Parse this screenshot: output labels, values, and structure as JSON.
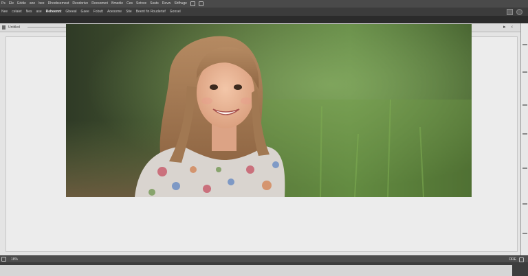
{
  "menubar": {
    "items": [
      "Ps",
      "Ele",
      "Eddie",
      "ane",
      "bee",
      "Dhoobsemost",
      "Reodorive",
      "Rocsomeri",
      "Bmedie",
      "Ces",
      "Sotvoc",
      "Ssuts",
      "Revw"
    ],
    "right_label": "Shfhuge"
  },
  "toolbar": {
    "items": [
      "Nee",
      "celaiet",
      "Nes",
      "ase",
      "Reheennt",
      "Gbeeal",
      "Gaee",
      "Fobutt",
      "Aoesome",
      "Stie",
      "Beent fin Roudertef",
      "Gonsel"
    ]
  },
  "tabstrip": {
    "label": "Untitled"
  },
  "canvas": {
    "photo_alt": "Smiling girl with long hair in a floral dress against a blurred green forest background"
  },
  "statusbar": {
    "zoom": "18%",
    "right_label": "DRE"
  },
  "colors": {
    "app_dark": "#3a3a3a",
    "canvas_bg": "#e4e4e4",
    "accent_green": "#4f7a2f"
  }
}
